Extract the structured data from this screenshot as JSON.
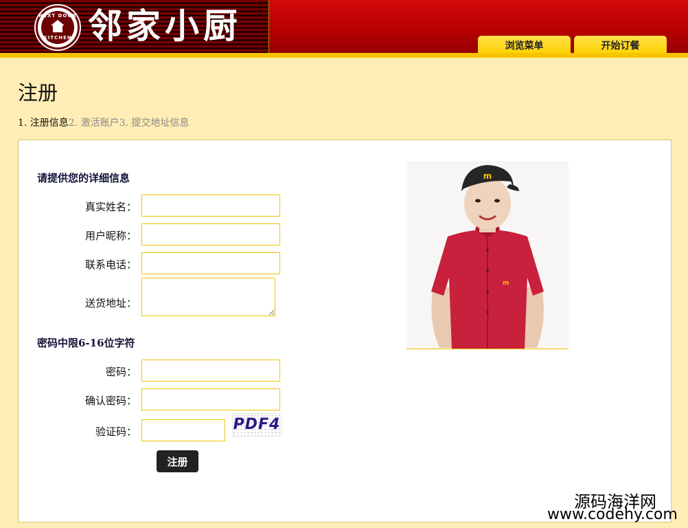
{
  "header": {
    "logo_title": "邻家小厨",
    "logo_badge_top": "NEXT DOOR",
    "logo_badge_bottom": "KITCHEN",
    "nav": {
      "browse_menu": "浏览菜单",
      "start_order": "开始订餐"
    }
  },
  "page": {
    "title": "注册",
    "steps": [
      "1. 注册信息",
      "2. 激活账户",
      "3. 提交地址信息"
    ]
  },
  "form": {
    "details_heading": "请提供您的详细信息",
    "real_name_label": "真实姓名：",
    "nickname_label": "用户昵称：",
    "phone_label": "联系电话：",
    "address_label": "送货地址：",
    "password_heading": "密码中限6-16位字符",
    "password_label": "密码：",
    "confirm_password_label": "确认密码：",
    "captcha_label": "验证码：",
    "captcha_text": "PDF4",
    "submit_label": "注册"
  },
  "watermark": {
    "cn": "源码海洋网",
    "url": "www.codehy.com"
  },
  "colors": {
    "header_red": "#c80000",
    "accent_gold": "#ffd200",
    "page_bg": "#ffedb5",
    "input_border": "#f2c200",
    "button_dark": "#222222"
  }
}
